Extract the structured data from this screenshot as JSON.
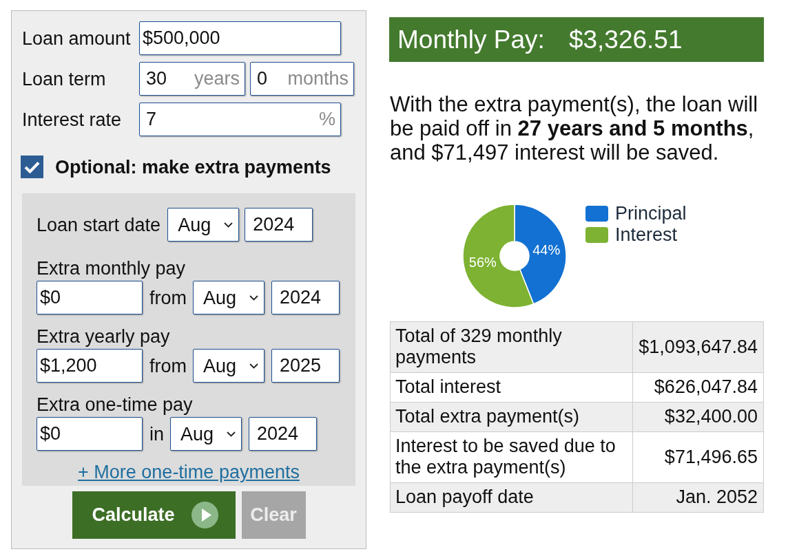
{
  "loan_form": {
    "loan_amount": {
      "label": "Loan amount",
      "value": "$500,000"
    },
    "loan_term": {
      "label": "Loan term",
      "years": {
        "value": "30",
        "unit": "years"
      },
      "months": {
        "value": "0",
        "unit": "months"
      }
    },
    "interest_rate": {
      "label": "Interest rate",
      "value": "7",
      "unit": "%"
    },
    "extra_payments": {
      "label": "Optional: make extra payments",
      "checked": true,
      "start_date": {
        "label": "Loan start date",
        "month": "Aug",
        "year": "2024"
      },
      "items": [
        {
          "label": "Extra monthly pay",
          "amount": "$0",
          "preposition": "from",
          "month": "Aug",
          "year": "2024"
        },
        {
          "label": "Extra yearly pay",
          "amount": "$1,200",
          "preposition": "from",
          "month": "Aug",
          "year": "2025"
        },
        {
          "label": "Extra one-time pay",
          "amount": "$0",
          "preposition": "in",
          "month": "Aug",
          "year": "2024"
        }
      ],
      "more_link": "+ More one-time payments"
    },
    "buttons": [
      {
        "label": "Calculate",
        "kind": "primary"
      },
      {
        "label": "Clear",
        "kind": "secondary"
      }
    ]
  },
  "results": {
    "monthly_pay": {
      "label": "Monthly Pay:",
      "value": "$3,326.51"
    },
    "summary": "With the extra payment(s), the loan will be paid off in **27 years and 5 months**, and $71,497 interest will be saved.",
    "chart_data": {
      "type": "donut",
      "categories": [
        "Principal",
        "Interest"
      ],
      "values": [
        44,
        56
      ],
      "colors": [
        "#1271d2",
        "#7db232"
      ],
      "value_labels": [
        "44%",
        "56%"
      ],
      "legend": "right"
    },
    "table": {
      "rows": [
        {
          "label": "Total of 329 monthly payments",
          "value": "$1,093,647.84"
        },
        {
          "label": "Total interest",
          "value": "$626,047.84"
        },
        {
          "label": "Total extra payment(s)",
          "value": "$32,400.00"
        },
        {
          "label": "Interest to be saved due to the extra payment(s)",
          "value": "$71,496.65"
        },
        {
          "label": "Loan payoff date",
          "value": "Jan. 2052"
        }
      ]
    }
  }
}
